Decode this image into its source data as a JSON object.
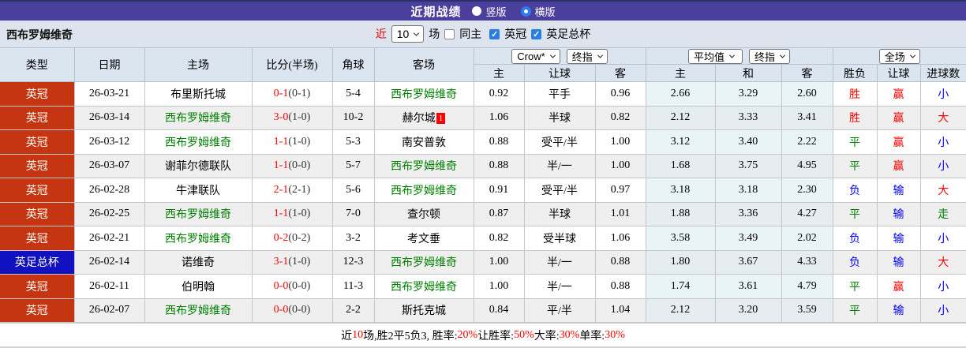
{
  "colors": {
    "bar_purple": "#4b3f9e",
    "league_red": "#c63512",
    "cup_blue": "#1111c0",
    "self_green": "#008000",
    "win_red": "#ff0000",
    "lose_blue": "#0000ff",
    "draw_green": "#008000"
  },
  "title_bar": {
    "title": "近期战绩",
    "radio_vertical": "竖版",
    "radio_horizontal": "横版",
    "selected": "横版"
  },
  "filter_bar": {
    "team": "西布罗姆维奇",
    "near_label": "近",
    "count_value": "10",
    "games_label": "场",
    "same_home_label": "同主",
    "same_home_checked": false,
    "league_label": "英冠",
    "league_checked": true,
    "cup_label": "英足总杯",
    "cup_checked": true,
    "check_glyph": "✓"
  },
  "table": {
    "group_headers": {
      "asian_select_1": "Crow*",
      "asian_select_2": "终指",
      "euro_select_1": "平均值",
      "euro_select_2": "终指",
      "scope_select": "全场"
    },
    "columns": {
      "type": "类型",
      "date": "日期",
      "home": "主场",
      "score": "比分(半场)",
      "corner": "角球",
      "away": "客场",
      "asian_home": "主",
      "asian_line": "让球",
      "asian_away": "客",
      "euro_home": "主",
      "euro_draw": "和",
      "euro_away": "客",
      "result": "胜负",
      "handicap": "让球",
      "goals": "进球数"
    },
    "rows": [
      {
        "league": "英冠",
        "league_type": "league",
        "date": "26-03-21",
        "home": "布里斯托城",
        "home_self": false,
        "score": "0-1",
        "half": "(0-1)",
        "corner": "5-4",
        "away": "西布罗姆维奇",
        "away_self": true,
        "asian_home": "0.92",
        "asian_line": "平手",
        "asian_away": "0.96",
        "euro_home": "2.66",
        "euro_draw": "3.29",
        "euro_away": "2.60",
        "result": "胜",
        "result_c": "r",
        "let": "赢",
        "let_c": "r",
        "goal": "小",
        "goal_c": "b"
      },
      {
        "league": "英冠",
        "league_type": "league",
        "date": "26-03-14",
        "home": "西布罗姆维奇",
        "home_self": true,
        "score": "3-0",
        "half": "(1-0)",
        "corner": "10-2",
        "away": "赫尔城",
        "away_self": false,
        "away_badge": "1",
        "asian_home": "1.06",
        "asian_line": "半球",
        "asian_away": "0.82",
        "euro_home": "2.12",
        "euro_draw": "3.33",
        "euro_away": "3.41",
        "result": "胜",
        "result_c": "r",
        "let": "赢",
        "let_c": "r",
        "goal": "大",
        "goal_c": "r"
      },
      {
        "league": "英冠",
        "league_type": "league",
        "date": "26-03-12",
        "home": "西布罗姆维奇",
        "home_self": true,
        "score": "1-1",
        "half": "(1-0)",
        "corner": "5-3",
        "away": "南安普敦",
        "away_self": false,
        "asian_home": "0.88",
        "asian_line": "受平/半",
        "asian_away": "1.00",
        "euro_home": "3.12",
        "euro_draw": "3.40",
        "euro_away": "2.22",
        "result": "平",
        "result_c": "g",
        "let": "赢",
        "let_c": "r",
        "goal": "小",
        "goal_c": "b"
      },
      {
        "league": "英冠",
        "league_type": "league",
        "date": "26-03-07",
        "home": "谢菲尔德联队",
        "home_self": false,
        "score": "1-1",
        "half": "(0-0)",
        "corner": "5-7",
        "away": "西布罗姆维奇",
        "away_self": true,
        "asian_home": "0.88",
        "asian_line": "半/一",
        "asian_away": "1.00",
        "euro_home": "1.68",
        "euro_draw": "3.75",
        "euro_away": "4.95",
        "result": "平",
        "result_c": "g",
        "let": "赢",
        "let_c": "r",
        "goal": "小",
        "goal_c": "b"
      },
      {
        "league": "英冠",
        "league_type": "league",
        "date": "26-02-28",
        "home": "牛津联队",
        "home_self": false,
        "score": "2-1",
        "half": "(2-1)",
        "corner": "5-6",
        "away": "西布罗姆维奇",
        "away_self": true,
        "asian_home": "0.91",
        "asian_line": "受平/半",
        "asian_away": "0.97",
        "euro_home": "3.18",
        "euro_draw": "3.18",
        "euro_away": "2.30",
        "result": "负",
        "result_c": "b",
        "let": "输",
        "let_c": "b",
        "goal": "大",
        "goal_c": "r"
      },
      {
        "league": "英冠",
        "league_type": "league",
        "date": "26-02-25",
        "home": "西布罗姆维奇",
        "home_self": true,
        "score": "1-1",
        "half": "(1-0)",
        "corner": "7-0",
        "away": "查尔顿",
        "away_self": false,
        "asian_home": "0.87",
        "asian_line": "半球",
        "asian_away": "1.01",
        "euro_home": "1.88",
        "euro_draw": "3.36",
        "euro_away": "4.27",
        "result": "平",
        "result_c": "g",
        "let": "输",
        "let_c": "b",
        "goal": "走",
        "goal_c": "g"
      },
      {
        "league": "英冠",
        "league_type": "league",
        "date": "26-02-21",
        "home": "西布罗姆维奇",
        "home_self": true,
        "score": "0-2",
        "half": "(0-2)",
        "corner": "3-2",
        "away": "考文垂",
        "away_self": false,
        "asian_home": "0.82",
        "asian_line": "受半球",
        "asian_away": "1.06",
        "euro_home": "3.58",
        "euro_draw": "3.49",
        "euro_away": "2.02",
        "result": "负",
        "result_c": "b",
        "let": "输",
        "let_c": "b",
        "goal": "小",
        "goal_c": "b"
      },
      {
        "league": "英足总杯",
        "league_type": "cup",
        "date": "26-02-14",
        "home": "诺维奇",
        "home_self": false,
        "score": "3-1",
        "half": "(1-0)",
        "corner": "12-3",
        "away": "西布罗姆维奇",
        "away_self": true,
        "asian_home": "1.00",
        "asian_line": "半/一",
        "asian_away": "0.88",
        "euro_home": "1.80",
        "euro_draw": "3.67",
        "euro_away": "4.33",
        "result": "负",
        "result_c": "b",
        "let": "输",
        "let_c": "b",
        "goal": "大",
        "goal_c": "r"
      },
      {
        "league": "英冠",
        "league_type": "league",
        "date": "26-02-11",
        "home": "伯明翰",
        "home_self": false,
        "score": "0-0",
        "half": "(0-0)",
        "corner": "11-3",
        "away": "西布罗姆维奇",
        "away_self": true,
        "asian_home": "1.00",
        "asian_line": "半/一",
        "asian_away": "0.88",
        "euro_home": "1.74",
        "euro_draw": "3.61",
        "euro_away": "4.79",
        "result": "平",
        "result_c": "g",
        "let": "赢",
        "let_c": "r",
        "goal": "小",
        "goal_c": "b"
      },
      {
        "league": "英冠",
        "league_type": "league",
        "date": "26-02-07",
        "home": "西布罗姆维奇",
        "home_self": true,
        "score": "0-0",
        "half": "(0-0)",
        "corner": "2-2",
        "away": "斯托克城",
        "away_self": false,
        "asian_home": "0.84",
        "asian_line": "平/半",
        "asian_away": "1.04",
        "euro_home": "2.12",
        "euro_draw": "3.20",
        "euro_away": "3.59",
        "result": "平",
        "result_c": "g",
        "let": "输",
        "let_c": "b",
        "goal": "小",
        "goal_c": "b"
      }
    ]
  },
  "footer": {
    "segments": [
      {
        "t": "近"
      },
      {
        "t": "10",
        "red": true
      },
      {
        "t": "场,胜2平5负3, 胜率:"
      },
      {
        "t": "20%",
        "red": true
      },
      {
        "t": " 让胜率:"
      },
      {
        "t": "50%",
        "red": true
      },
      {
        "t": " 大率:"
      },
      {
        "t": "30%",
        "red": true
      },
      {
        "t": " 单率:"
      },
      {
        "t": "30%",
        "red": true
      }
    ]
  }
}
